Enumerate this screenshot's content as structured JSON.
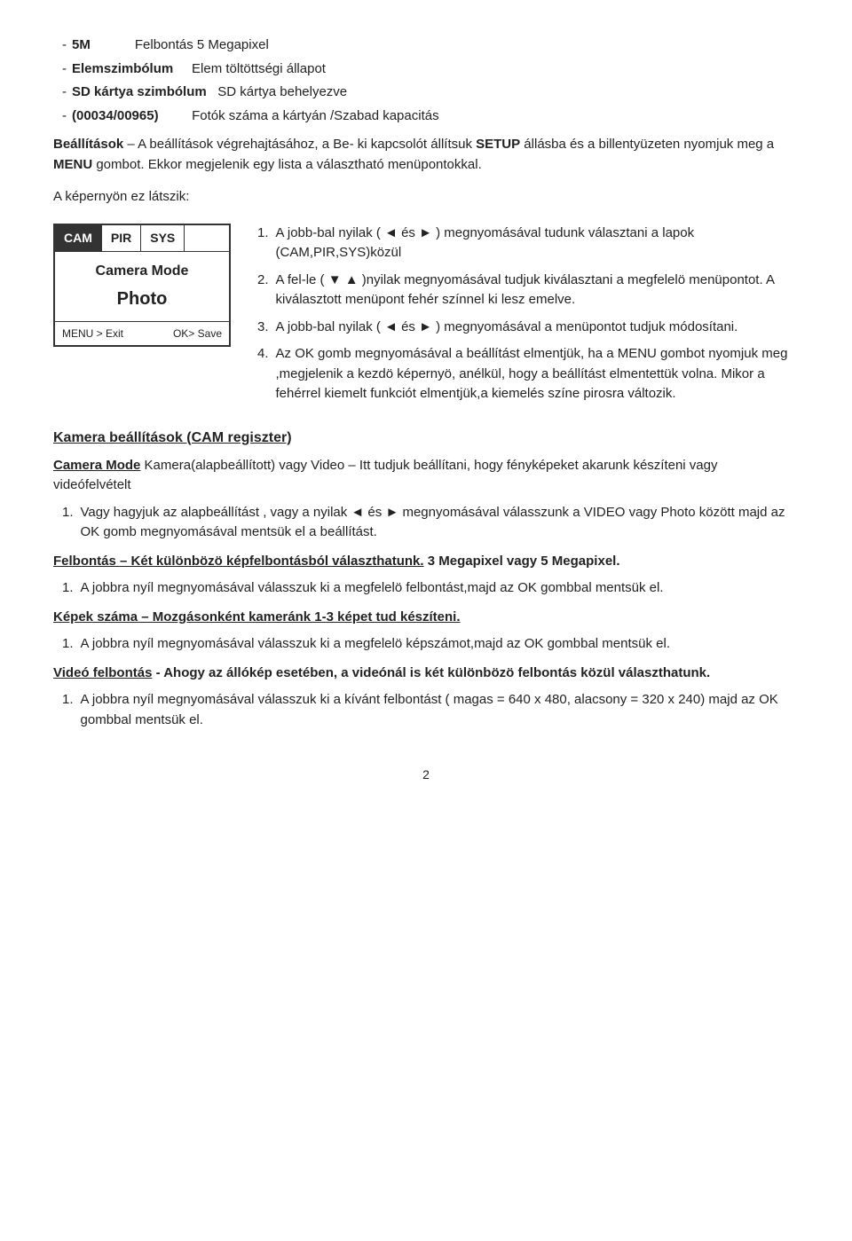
{
  "intro_bullets": [
    {
      "dash": "-",
      "label": "5M",
      "text": "Felbontás 5 Megapixel"
    },
    {
      "dash": "-",
      "label": "Elemszimbólum",
      "text": "Elem töltöttségi állapot"
    },
    {
      "dash": "-",
      "label": "SD kártya szimbólum",
      "text": "SD kártya behelyezve"
    },
    {
      "dash": "-",
      "label": "(00034/00965)",
      "text": "Fotók száma a kártyán /Szabad kapacitás"
    }
  ],
  "beallitasok_para1": "Beállítások – A beállítások végrehajtásához, a Be- ki kapcsolót állítsuk SETUP állásba és a billentyüzeten nyomjuk meg a MENU gombot. Ekkor megjelenik egy lista a választható menüpontokkal.",
  "kepernyon_label": "A képernyön ez látszik:",
  "screen": {
    "tabs": [
      {
        "label": "CAM",
        "active": true
      },
      {
        "label": "PIR",
        "active": false
      },
      {
        "label": "SYS",
        "active": false
      }
    ],
    "mode_label": "Camera Mode",
    "mode_value": "Photo",
    "footer_left": "MENU > Exit",
    "footer_right": "OK> Save"
  },
  "instructions": [
    {
      "num": "1.",
      "text": "A jobb-bal nyilak ( ◄ és ► ) megnyomásával tudunk választani a lapok (CAM,PIR,SYS)közül"
    },
    {
      "num": "2.",
      "text": "A fel-le ( ▼ ▲ )nyilak megnyomásával tudjuk kiválasztani a megfelelö menüpontot. A kiválasztott menüpont fehér színnel ki lesz emelve."
    },
    {
      "num": "3.",
      "text": "A jobb-bal nyilak ( ◄ és ► ) megnyomásával a menüpontot tudjuk módosítani."
    },
    {
      "num": "4.",
      "text": "Az OK gomb megnyomásával a beállítást elmentjük, ha a MENU gombot nyomjuk meg ,megjelenik a kezdö képernyö, anélkül, hogy a beállítást elmentettük volna. Mikor a fehérrel kiemelt funkciót elmentjük,a kiemelés színe pirosra változik."
    }
  ],
  "kamera_section": {
    "heading": "Kamera beállítások (CAM regiszter)",
    "camera_mode_heading": "Camera Mode Kamera(alapbeállított) vagy Video – Itt tudjuk beállítani, hogy fényképeket akarunk készíteni vagy videófelvételt",
    "camera_mode_items": [
      {
        "num": "1.",
        "text": "Vagy hagyjuk az alapbeállítást , vagy a nyilak ◄ és ► megnyomásával válasszunk a VIDEO vagy Photo között majd az OK gomb megnyomásával mentsük el a beállítást."
      }
    ]
  },
  "felbontas_section": {
    "heading": "Felbontás – Két különbözö képfelbontásból választhatunk.",
    "heading_suffix": " 3 Megapixel vagy 5 Megapixel.",
    "items": [
      {
        "num": "1.",
        "text": "A jobbra nyíl megnyomásával válasszuk ki a megfelelö felbontást,majd az OK gombbal mentsük el."
      }
    ]
  },
  "kepek_section": {
    "heading": "Képek száma – Mozgásonként kameránk 1-3 képet tud készíteni.",
    "items": [
      {
        "num": "1.",
        "text": "A jobbra nyíl megnyomásával válasszuk ki a megfelelö képszámot,majd az OK gombbal mentsük el."
      }
    ]
  },
  "video_section": {
    "heading": "Videó felbontás - Ahogy az állókép esetében, a videónál is két különbözö felbontás közül választhatunk.",
    "items": [
      {
        "num": "1.",
        "text": "A jobbra nyíl megnyomásával válasszuk ki a kívánt felbontást ( magas = 640 x 480, alacsony = 320 x 240) majd az OK gombbal mentsük el."
      }
    ]
  },
  "page_number": "2"
}
